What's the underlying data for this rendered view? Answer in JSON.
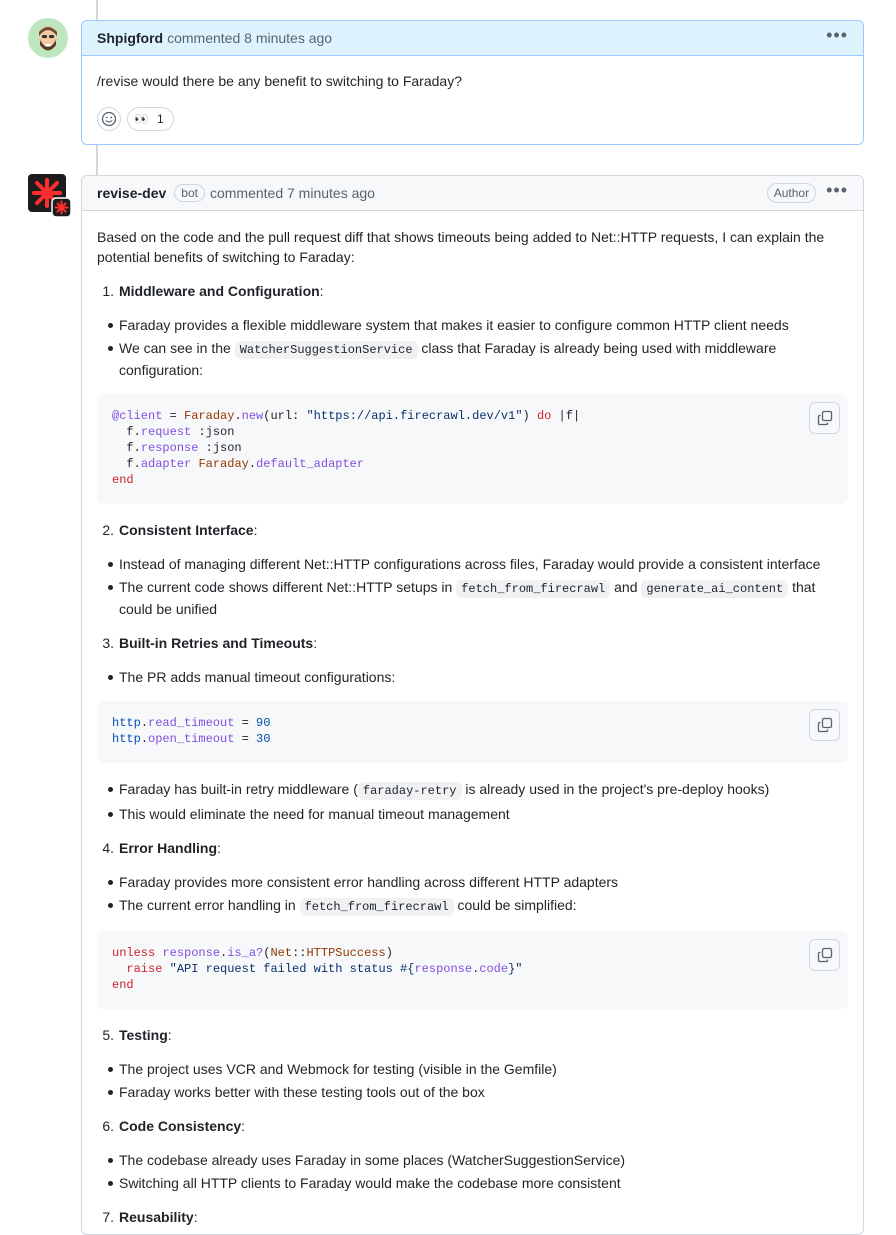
{
  "comment1": {
    "author": "Shpigford",
    "meta": "commented 8 minutes ago",
    "body": "/revise would there be any benefit to switching to Faraday?",
    "reaction_emoji": "👀",
    "reaction_count": "1"
  },
  "comment2": {
    "author": "revise-dev",
    "bot_badge": "bot",
    "meta": "commented 7 minutes ago",
    "author_badge": "Author",
    "intro": "Based on the code and the pull request diff that shows timeouts being added to Net::HTTP requests, I can explain the potential benefits of switching to Faraday:",
    "s1": {
      "num": "1.",
      "title": "Middleware and Configuration",
      "colon": ":",
      "b1": "Faraday provides a flexible middleware system that makes it easier to configure common HTTP client needs",
      "b2_pre": "We can see in the ",
      "b2_code": "WatcherSuggestionService",
      "b2_post": " class that Faraday is already being used with middleware configuration:",
      "code": {
        "l1": [
          "@client",
          " = ",
          "Faraday",
          ".",
          "new",
          "(url: ",
          "\"https://api.firecrawl.dev/v1\"",
          ") ",
          "do",
          " |f|"
        ],
        "l2": [
          "  f.",
          "request",
          " :json"
        ],
        "l3": [
          "  f.",
          "response",
          " :json"
        ],
        "l4": [
          "  f.",
          "adapter",
          " ",
          "Faraday",
          ".",
          "default_adapter"
        ],
        "l5": [
          "end"
        ]
      }
    },
    "s2": {
      "num": "2.",
      "title": "Consistent Interface",
      "colon": ":",
      "b1": "Instead of managing different Net::HTTP configurations across files, Faraday would provide a consistent interface",
      "b2_pre": "The current code shows different Net::HTTP setups in ",
      "b2_code1": "fetch_from_firecrawl",
      "b2_mid": " and ",
      "b2_code2": "generate_ai_content",
      "b2_post": " that could be unified"
    },
    "s3": {
      "num": "3.",
      "title": "Built-in Retries and Timeouts",
      "colon": ":",
      "b1": "The PR adds manual timeout configurations:",
      "code": {
        "l1": [
          "http",
          ".",
          "read_timeout",
          " = ",
          "90"
        ],
        "l2": [
          "http",
          ".",
          "open_timeout",
          " = ",
          "30"
        ]
      },
      "b2_pre": "Faraday has built-in retry middleware (",
      "b2_code": "faraday-retry",
      "b2_post": " is already used in the project's pre-deploy hooks)",
      "b3": "This would eliminate the need for manual timeout management"
    },
    "s4": {
      "num": "4.",
      "title": "Error Handling",
      "colon": ":",
      "b1": "Faraday provides more consistent error handling across different HTTP adapters",
      "b2_pre": "The current error handling in ",
      "b2_code": "fetch_from_firecrawl",
      "b2_post": " could be simplified:",
      "code": {
        "l1": [
          "unless",
          " ",
          "response",
          ".",
          "is_a?",
          "(",
          "Net",
          "::",
          "HTTPSuccess",
          ")"
        ],
        "l2": [
          "  ",
          "raise",
          " \"API request failed with status #{",
          "response",
          ".",
          "code",
          "}\""
        ],
        "l3": [
          "end"
        ]
      }
    },
    "s5": {
      "num": "5.",
      "title": "Testing",
      "colon": ":",
      "b1": "The project uses VCR and Webmock for testing (visible in the Gemfile)",
      "b2": "Faraday works better with these testing tools out of the box"
    },
    "s6": {
      "num": "6.",
      "title": "Code Consistency",
      "colon": ":",
      "b1": "The codebase already uses Faraday in some places (WatcherSuggestionService)",
      "b2": "Switching all HTTP clients to Faraday would make the codebase more consistent"
    },
    "s7": {
      "num": "7.",
      "title": "Reusability",
      "colon": ":"
    }
  },
  "icons": {
    "kebab": "kebab-horizontal-icon",
    "copy": "copy-icon",
    "smiley": "smiley-icon"
  },
  "colors": {
    "highlight_border": "#9ec7ff",
    "highlight_header": "#ddf4ff",
    "bot_avatar": "#ff2d2d"
  }
}
